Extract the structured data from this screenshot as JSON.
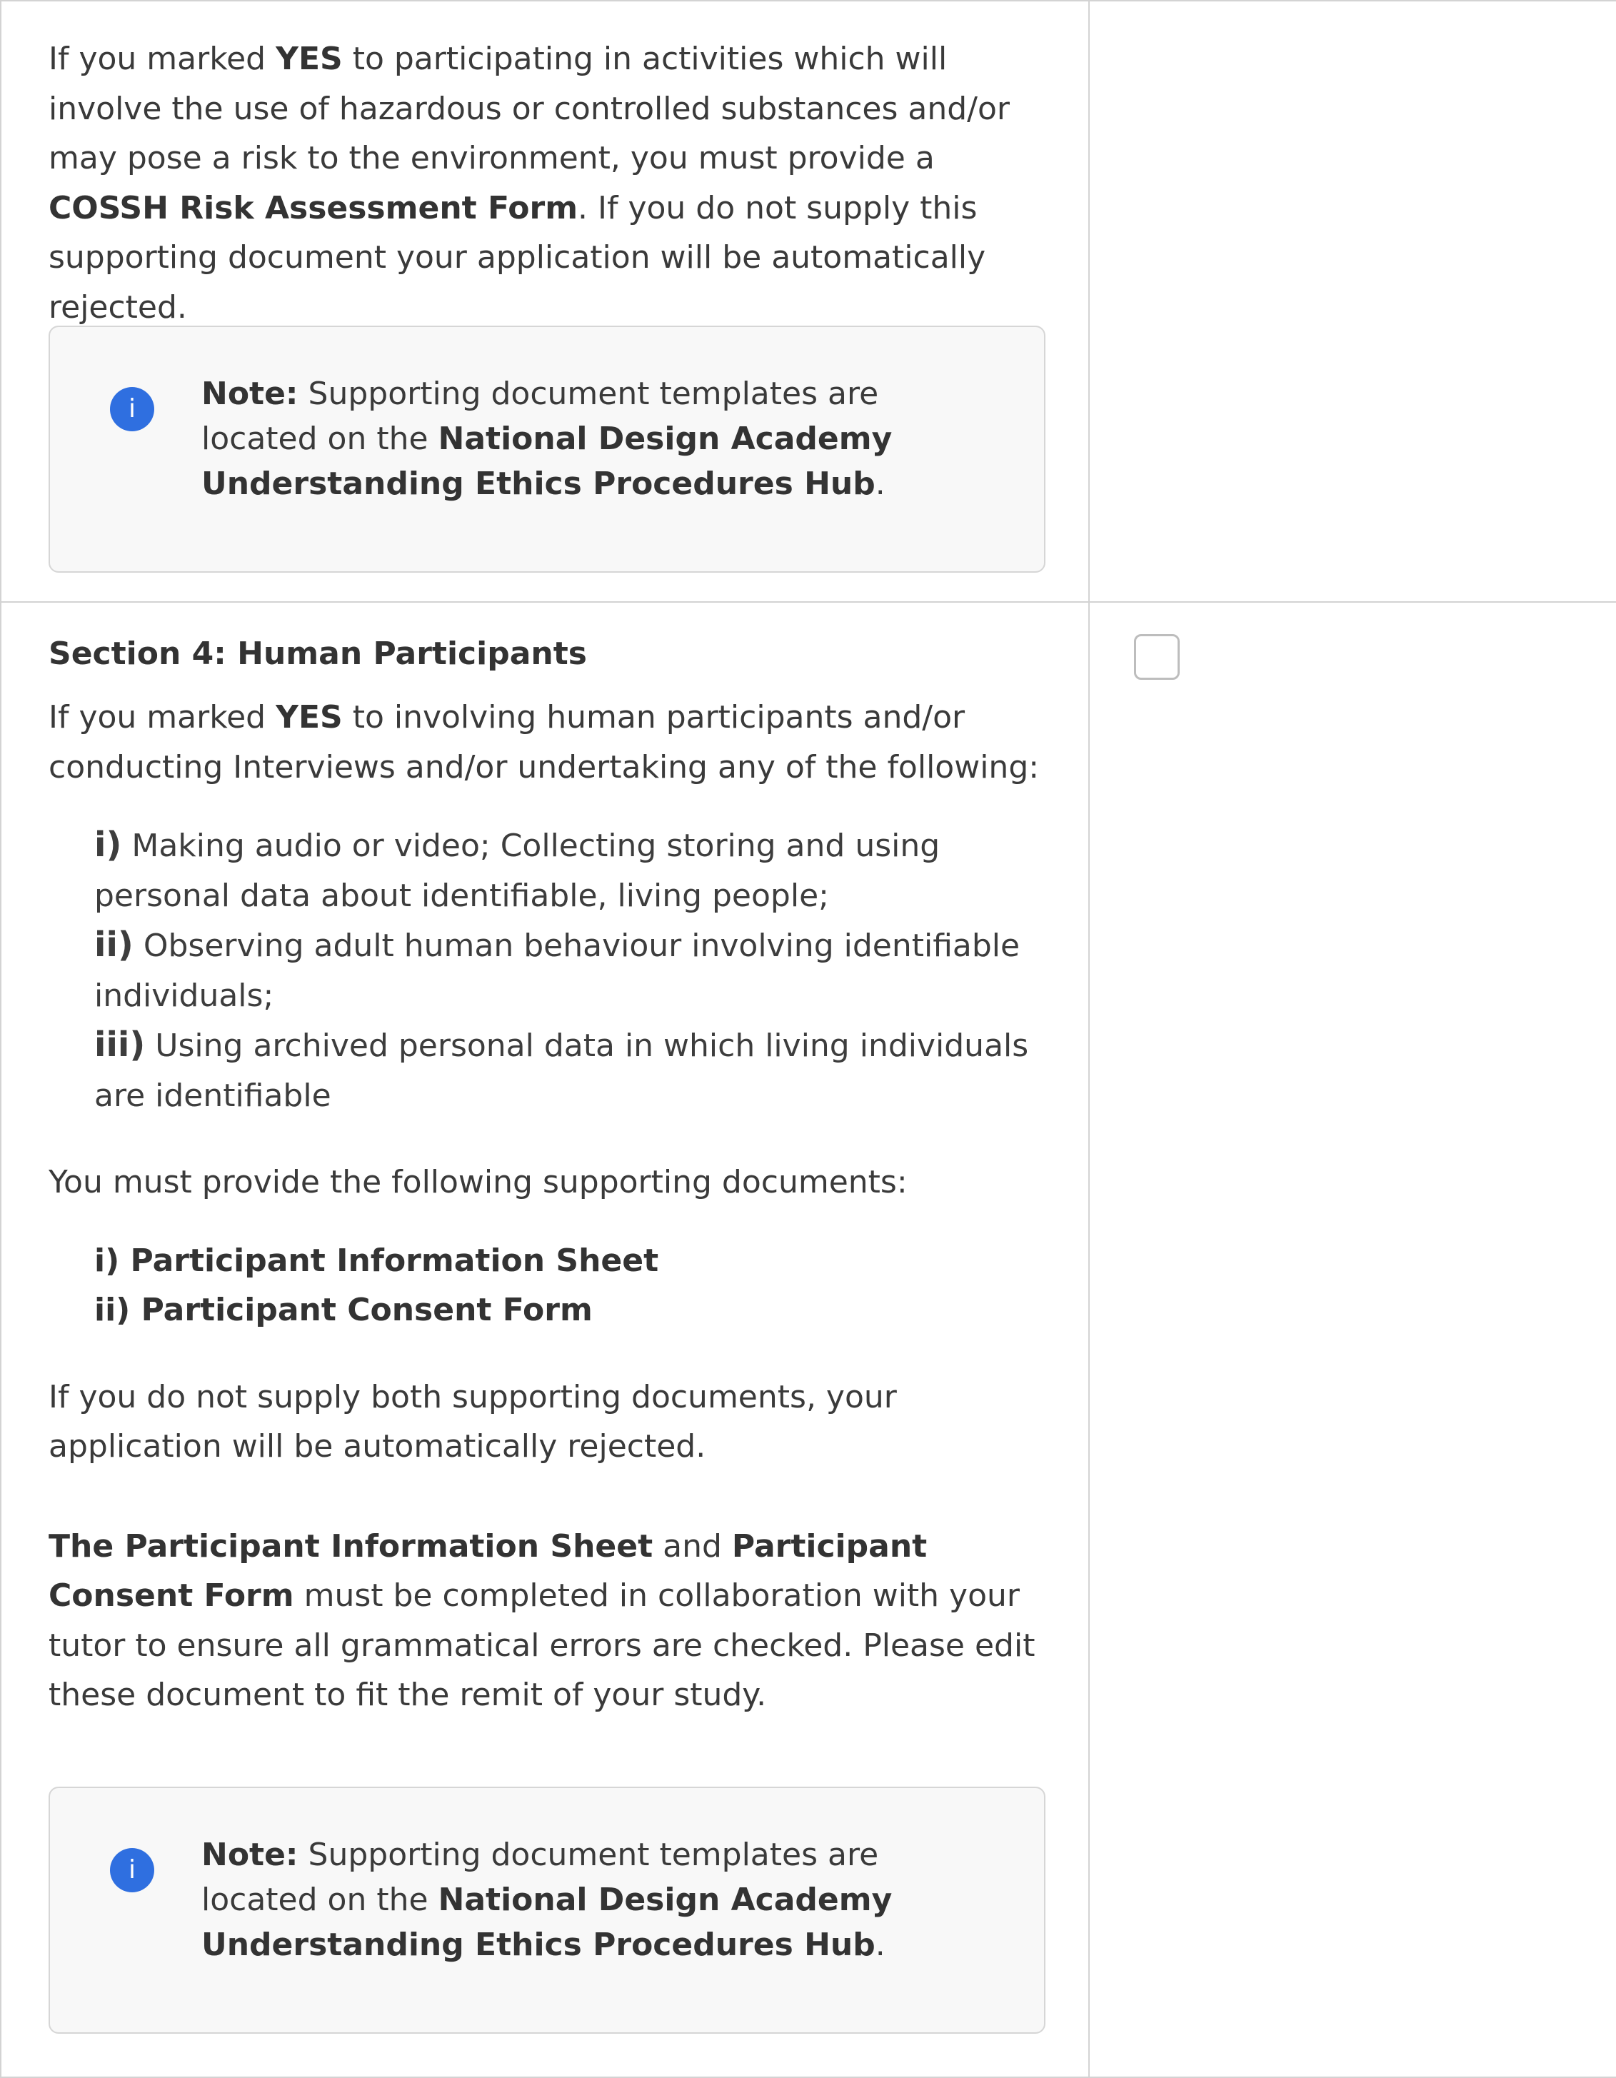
{
  "row1": {
    "para": {
      "t1": "If you marked ",
      "yes": "YES",
      "t2": " to participating in activities which will involve the use of hazardous or controlled substances and/or may pose a risk to the environment, you must provide a ",
      "form": "COSSH Risk Assessment Form",
      "t3": ". If you do not supply this supporting document your application will be automatically rejected."
    },
    "note": {
      "label": "Note:",
      "t1": " Supporting document templates are located on the ",
      "hub": "National Design Academy Understanding Ethics Procedures Hub",
      "t2": "."
    }
  },
  "row2": {
    "heading": "Section 4: Human Participants",
    "intro": {
      "t1": "If you marked ",
      "yes": "YES",
      "t2": " to involving human participants and/or conducting Interviews and/or undertaking any of the following:"
    },
    "activities": [
      {
        "num": "i)",
        "text": " Making audio or video; Collecting storing and using personal data about identifiable, living people;"
      },
      {
        "num": "ii)",
        "text": "  Observing adult human behaviour involving identifiable individuals;"
      },
      {
        "num": "iii)",
        "text": " Using archived personal data in which living individuals are identifiable"
      }
    ],
    "must_provide": "You must provide the following supporting documents:",
    "documents": [
      "i) Participant Information Sheet",
      "ii) Participant Consent Form"
    ],
    "reject": "If you do not supply both supporting documents, your application will be automatically rejected.",
    "collab": {
      "pis": "The Participant Information Sheet",
      "and": " and ",
      "pcf": "Participant Consent Form",
      "t1": " must be completed in collaboration with your tutor to ensure all grammatical errors are checked. Please edit these document to fit the remit of your study."
    },
    "note": {
      "label": "Note:",
      "t1": " Supporting document templates are located on the ",
      "hub": "National Design Academy Understanding Ethics Procedures Hub",
      "t2": "."
    }
  },
  "icons": {
    "info": "i"
  },
  "colors": {
    "info_icon": "#2f6fe0",
    "border": "#d3d3d3",
    "note_bg": "#f8f8f8"
  }
}
